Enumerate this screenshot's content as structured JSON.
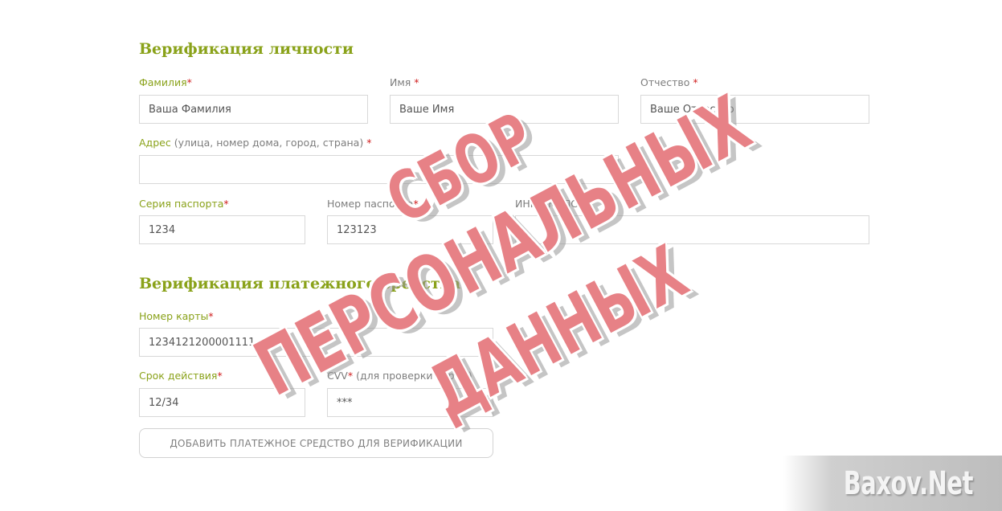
{
  "identity": {
    "title": "Верификация личности",
    "surname": {
      "label": "Фамилия",
      "star": "*",
      "value": "Ваша Фамилия"
    },
    "name": {
      "label": "Имя",
      "star": "*",
      "value": "Ваше Имя"
    },
    "patronymic": {
      "label": "Отчество",
      "star": "*",
      "value": "Ваше Отчество"
    },
    "address": {
      "label": "Адрес",
      "hint": "(улица, номер дома, город, страна)",
      "star": "*",
      "value": ""
    },
    "passport_series": {
      "label": "Серия паспорта",
      "star": "*",
      "value": "1234"
    },
    "passport_number": {
      "label": "Номер паспорта",
      "star": "*",
      "value": "123123"
    },
    "inn": {
      "label": "ИНН/СНИЛС",
      "star": "*",
      "value": ""
    }
  },
  "payment": {
    "title": "Верификация платежного средства",
    "card_number": {
      "label": "Номер карты",
      "star": "*",
      "value": "1234121200001111"
    },
    "expiry": {
      "label": "Срок действия",
      "star": "*",
      "value": "12/34"
    },
    "cvv": {
      "label": "CVV",
      "star": "*",
      "hint": "(для проверки карты)",
      "value": "***"
    },
    "add_button": "ДОБАВИТЬ ПЛАТЕЖНОЕ СРЕДСТВО ДЛЯ ВЕРИФИКАЦИИ"
  },
  "stamp": {
    "line1": "СБОР",
    "line2": "ПЕРСОНАЛЬНЫХ",
    "line3": "ДАННЫХ",
    "color": "#de5058"
  },
  "watermark": "Baxov.Net"
}
